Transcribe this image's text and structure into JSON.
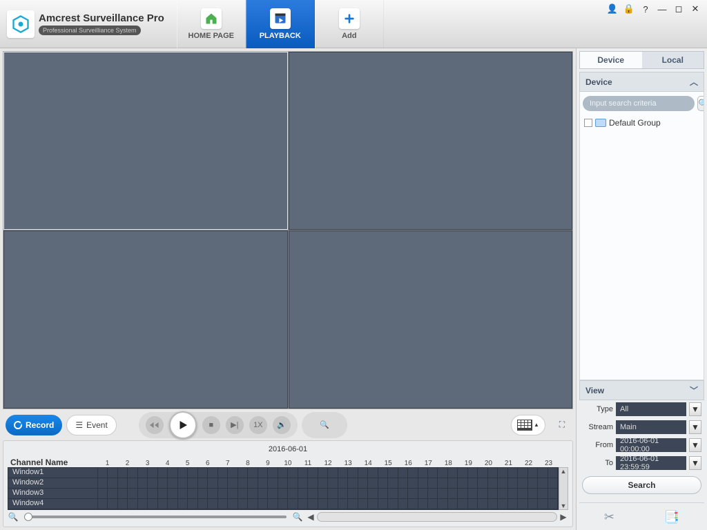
{
  "app": {
    "title": "Amcrest Surveillance Pro",
    "subtitle": "Professional Surveilliance System"
  },
  "tabs": {
    "home": "HOME PAGE",
    "playback": "PLAYBACK",
    "add": "Add"
  },
  "controls": {
    "record": "Record",
    "event": "Event",
    "speed": "1X"
  },
  "timeline": {
    "date": "2016-06-01",
    "channel_header": "Channel Name",
    "hours": [
      "1",
      "2",
      "3",
      "4",
      "5",
      "6",
      "7",
      "8",
      "9",
      "10",
      "11",
      "12",
      "13",
      "14",
      "15",
      "16",
      "17",
      "18",
      "19",
      "20",
      "21",
      "22",
      "23"
    ],
    "channels": [
      "Window1",
      "Window2",
      "Window3",
      "Window4"
    ]
  },
  "sidebar": {
    "tab_device": "Device",
    "tab_local": "Local",
    "panel_device": "Device",
    "search_placeholder": "Input search criteria",
    "default_group": "Default Group",
    "view": "View",
    "type_label": "Type",
    "type_value": "All",
    "stream_label": "Stream",
    "stream_value": "Main",
    "from_label": "From",
    "from_value": "2016-06-01 00:00:00",
    "to_label": "To",
    "to_value": "2016-06-01 23:59:59",
    "search_btn": "Search"
  }
}
